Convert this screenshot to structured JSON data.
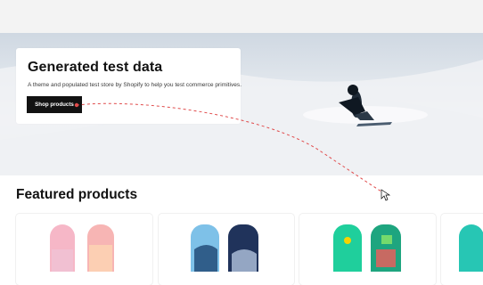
{
  "hero": {
    "title": "Generated test data",
    "subtitle": "A theme and populated test store by Shopify to help you test commerce primitives.",
    "button_label": "Shop products"
  },
  "featured": {
    "title": "Featured products"
  },
  "products": [
    {
      "image": "pink-snowboard"
    },
    {
      "image": "blue-snowboard"
    },
    {
      "image": "green-snowboard"
    },
    {
      "image": "partial-snowboard"
    }
  ],
  "colors": {
    "button_bg": "#121212",
    "annotation_path": "#e04b4b"
  }
}
